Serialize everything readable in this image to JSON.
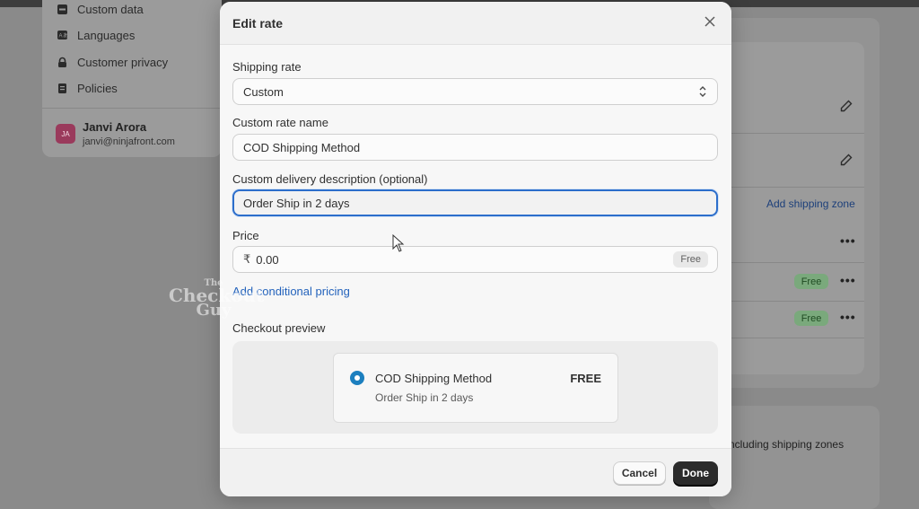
{
  "sidebar": {
    "items": [
      {
        "label": "Custom data",
        "icon": "database-icon"
      },
      {
        "label": "Languages",
        "icon": "translate-icon"
      },
      {
        "label": "Customer privacy",
        "icon": "lock-icon"
      },
      {
        "label": "Policies",
        "icon": "document-icon"
      }
    ],
    "user": {
      "initials": "JA",
      "name": "Janvi Arora",
      "email": "janvi@ninjafront.com"
    }
  },
  "background": {
    "add_shipping_zone": "Add shipping zone",
    "free_badges": [
      "Free",
      "Free"
    ],
    "more_label": "•••",
    "bottom_text": "ncluding shipping zones"
  },
  "modal": {
    "title": "Edit rate",
    "shipping_rate": {
      "label": "Shipping rate",
      "value": "Custom"
    },
    "rate_name": {
      "label": "Custom rate name",
      "value": "COD Shipping Method"
    },
    "delivery_desc": {
      "label": "Custom delivery description (optional)",
      "value": "Order Ship in 2 days"
    },
    "price": {
      "label": "Price",
      "currency": "₹",
      "value": "0.00",
      "tag": "Free"
    },
    "conditional_link": "Add conditional pricing",
    "preview": {
      "label": "Checkout preview",
      "name": "COD Shipping Method",
      "description": "Order Ship in 2 days",
      "price": "FREE"
    },
    "cancel_label": "Cancel",
    "done_label": "Done"
  },
  "watermark": {
    "line1": "The",
    "line2": "Checkout",
    "line3": "Guy"
  },
  "colors": {
    "accent": "#2c6ecb",
    "primary_button": "#2b2b2b",
    "link": "#2463bc"
  }
}
